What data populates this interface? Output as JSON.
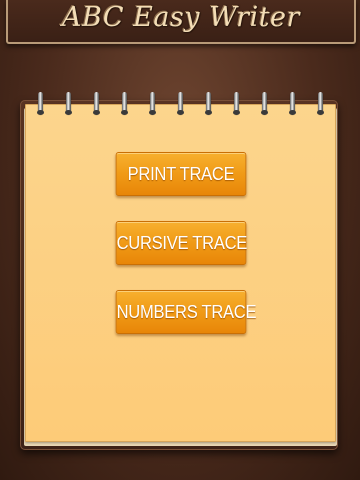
{
  "app": {
    "title": "ABC Easy Writer"
  },
  "menu": {
    "buttons": [
      {
        "label": "PRINT TRACE"
      },
      {
        "label": "CURSIVE TRACE"
      },
      {
        "label": "NUMBERS TRACE"
      }
    ]
  },
  "colors": {
    "background": "#4a2a1c",
    "paper": "#fdcf80",
    "button": "#f09a16",
    "title_text": "#f3ddb6"
  }
}
